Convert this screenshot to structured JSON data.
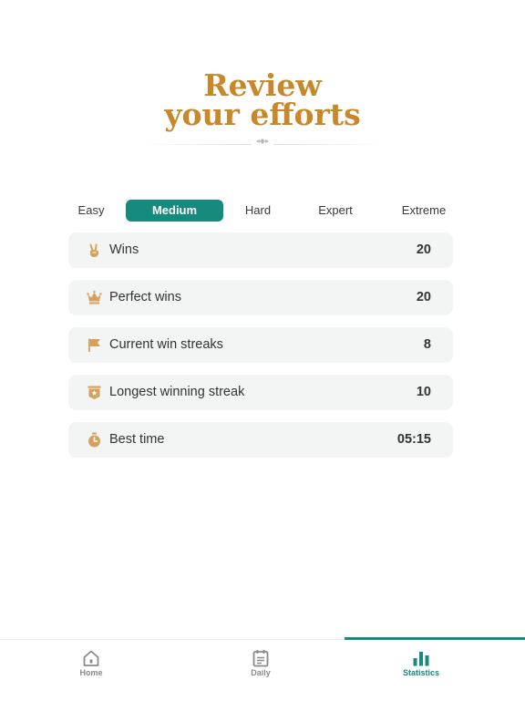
{
  "header": {
    "title_line1": "Review",
    "title_line2": "your efforts"
  },
  "tabs": [
    {
      "label": "Easy",
      "active": false
    },
    {
      "label": "Medium",
      "active": true
    },
    {
      "label": "Hard",
      "active": false
    },
    {
      "label": "Expert",
      "active": false
    },
    {
      "label": "Extreme",
      "active": false
    }
  ],
  "stats": [
    {
      "icon": "victory-hand-icon",
      "label": "Wins",
      "value": "20"
    },
    {
      "icon": "crown-icon",
      "label": "Perfect wins",
      "value": "20"
    },
    {
      "icon": "flag-icon",
      "label": "Current win streaks",
      "value": "8"
    },
    {
      "icon": "badge-star-icon",
      "label": "Longest winning streak",
      "value": "10"
    },
    {
      "icon": "stopwatch-icon",
      "label": "Best time",
      "value": "05:15"
    }
  ],
  "nav": [
    {
      "icon": "home-icon",
      "label": "Home",
      "active": false
    },
    {
      "icon": "calendar-icon",
      "label": "Daily",
      "active": false
    },
    {
      "icon": "bar-chart-icon",
      "label": "Statistics",
      "active": true
    }
  ],
  "colors": {
    "accent": "#168a7d",
    "title_gold": "#c8882a",
    "icon_gold": "#d6a15c",
    "row_bg": "#f3f4f4"
  }
}
